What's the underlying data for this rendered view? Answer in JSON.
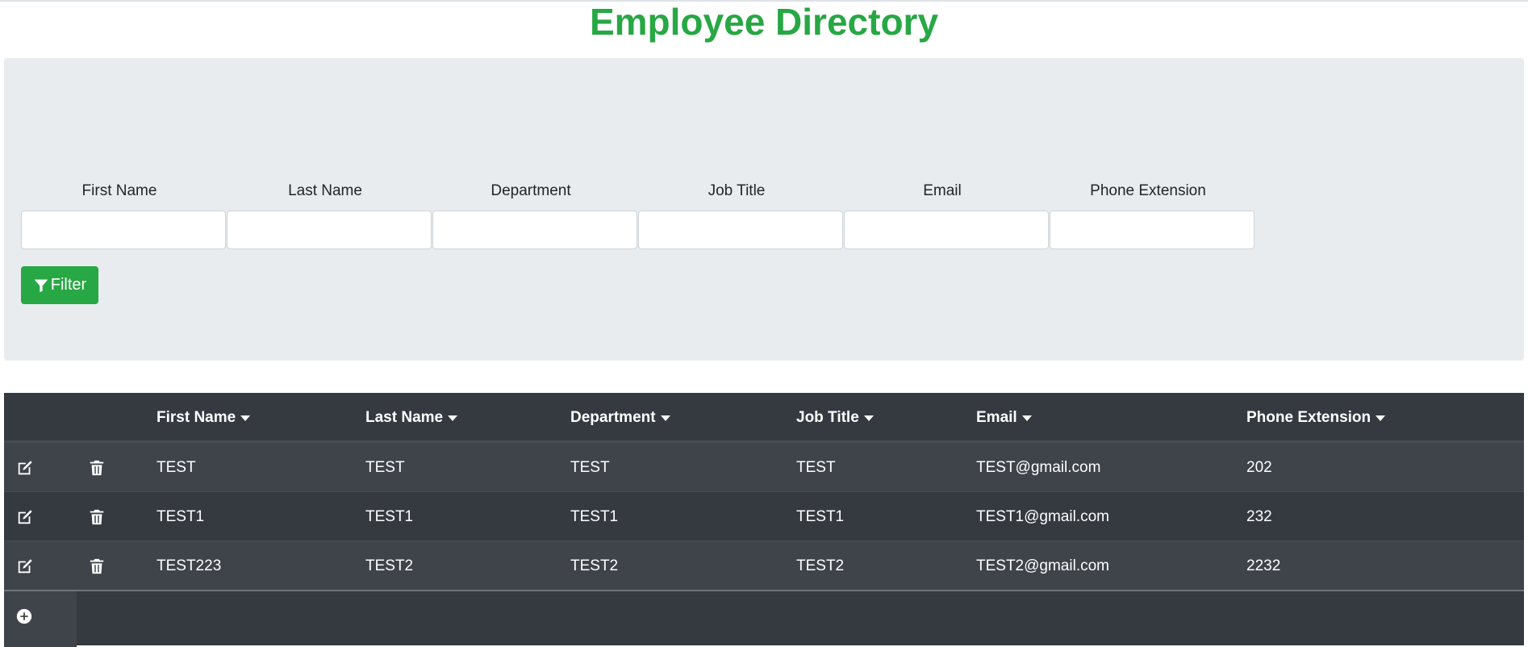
{
  "page": {
    "title": "Employee Directory"
  },
  "filters": {
    "fields": [
      {
        "label": "First Name",
        "value": "",
        "placeholder": ""
      },
      {
        "label": "Last Name",
        "value": "",
        "placeholder": ""
      },
      {
        "label": "Department",
        "value": "",
        "placeholder": ""
      },
      {
        "label": "Job Title",
        "value": "",
        "placeholder": ""
      },
      {
        "label": "Email",
        "value": "",
        "placeholder": ""
      },
      {
        "label": "Phone Extension",
        "value": "",
        "placeholder": ""
      }
    ],
    "button_label": "Filter",
    "button_icon": "filter-icon"
  },
  "table": {
    "columns": [
      "First Name",
      "Last Name",
      "Department",
      "Job Title",
      "Email",
      "Phone Extension"
    ],
    "sort_icon": "caret-down-icon",
    "row_icons": {
      "edit": "edit-icon",
      "delete": "trash-icon"
    },
    "rows": [
      [
        "TEST",
        "TEST",
        "TEST",
        "TEST",
        "TEST@gmail.com",
        "202"
      ],
      [
        "TEST1",
        "TEST1",
        "TEST1",
        "TEST1",
        "TEST1@gmail.com",
        "232"
      ],
      [
        "TEST223",
        "TEST2",
        "TEST2",
        "TEST2",
        "TEST2@gmail.com",
        "2232"
      ]
    ],
    "add_icon": "plus-circle-icon"
  },
  "colors": {
    "accent": "#28a745",
    "table_bg": "#343a40",
    "table_stripe": "#3e444a",
    "panel_bg": "#e9ecef"
  }
}
